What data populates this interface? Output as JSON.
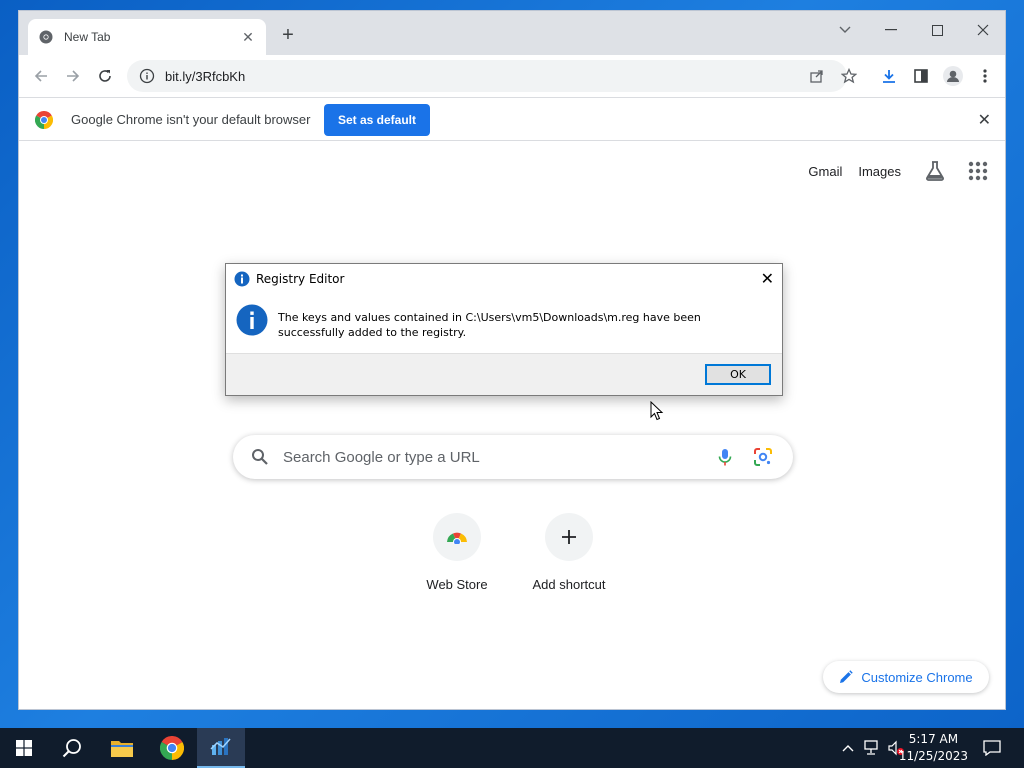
{
  "browser": {
    "tab_title": "New Tab",
    "url": "bit.ly/3RfcbKh"
  },
  "infobar": {
    "message": "Google Chrome isn't your default browser",
    "button_label": "Set as default"
  },
  "newtab": {
    "links": [
      "Gmail",
      "Images"
    ],
    "search_placeholder": "Search Google or type a URL",
    "shortcuts": [
      {
        "label": "Web Store"
      },
      {
        "label": "Add shortcut"
      }
    ],
    "customize_label": "Customize Chrome"
  },
  "dialog": {
    "title": "Registry Editor",
    "message": "The keys and values contained in C:\\Users\\vm5\\Downloads\\m.reg have been successfully added to the registry.",
    "ok_label": "OK"
  },
  "taskbar": {
    "time": "5:17 AM",
    "date": "11/25/2023"
  },
  "colors": {
    "accent": "#1a73e8",
    "taskbar": "#101c2c"
  }
}
